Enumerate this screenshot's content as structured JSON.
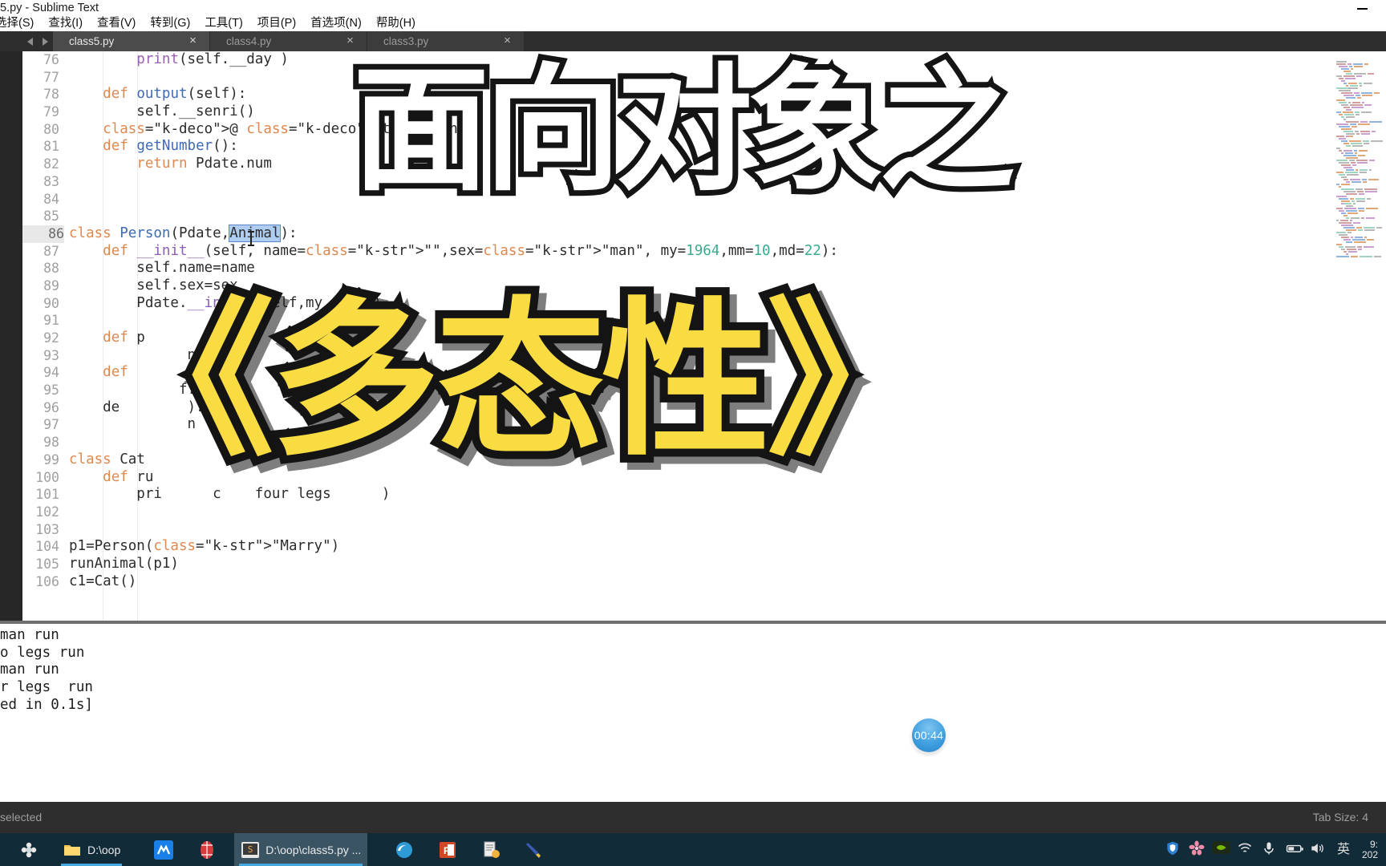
{
  "window": {
    "title": "5.py - Sublime Text",
    "minimize_label": "—"
  },
  "menubar": {
    "items": [
      {
        "label": "选择(S)",
        "name": "menu-select"
      },
      {
        "label": "查找(I)",
        "name": "menu-find"
      },
      {
        "label": "查看(V)",
        "name": "menu-view"
      },
      {
        "label": "转到(G)",
        "name": "menu-goto"
      },
      {
        "label": "工具(T)",
        "name": "menu-tools"
      },
      {
        "label": "项目(P)",
        "name": "menu-project"
      },
      {
        "label": "首选项(N)",
        "name": "menu-preferences"
      },
      {
        "label": "帮助(H)",
        "name": "menu-help"
      }
    ]
  },
  "tabs": {
    "nav_prev": "◀",
    "nav_next": "▶",
    "close_glyph": "×",
    "items": [
      {
        "label": "class5.py",
        "active": true
      },
      {
        "label": "class4.py",
        "active": false
      },
      {
        "label": "class3.py",
        "active": false
      }
    ]
  },
  "editor": {
    "first_line": 76,
    "cursor_line": 86,
    "selection_text": "Animal",
    "lines": [
      {
        "n": 76,
        "text": "        print(self.__day )"
      },
      {
        "n": 77,
        "text": ""
      },
      {
        "n": 78,
        "text": "    def output(self):"
      },
      {
        "n": 79,
        "text": "        self.__senri()"
      },
      {
        "n": 80,
        "text": "    @ staticmethod"
      },
      {
        "n": 81,
        "text": "    def getNumber():"
      },
      {
        "n": 82,
        "text": "        return Pdate.num"
      },
      {
        "n": 83,
        "text": ""
      },
      {
        "n": 84,
        "text": ""
      },
      {
        "n": 85,
        "text": ""
      },
      {
        "n": 86,
        "text": "class Person(Pdate,Animal):"
      },
      {
        "n": 87,
        "text": "    def __init__(self, name=\"\",sex=\"man\", my=1964,mm=10,md=22):"
      },
      {
        "n": 88,
        "text": "        self.name=name"
      },
      {
        "n": 89,
        "text": "        self.sex=sex"
      },
      {
        "n": 90,
        "text": "        Pdate.__init__(self,my,mm,md)"
      },
      {
        "n": 91,
        "text": ""
      },
      {
        "n": 92,
        "text": "    def p        lf):"
      },
      {
        "n": 93,
        "text": "              name"
      },
      {
        "n": 94,
        "text": "    def        elf)"
      },
      {
        "n": 95,
        "text": "             f.sex)"
      },
      {
        "n": 96,
        "text": "    de        ):"
      },
      {
        "n": 97,
        "text": "              n ·"
      },
      {
        "n": 98,
        "text": ""
      },
      {
        "n": 99,
        "text": "class Cat"
      },
      {
        "n": 100,
        "text": "    def ru"
      },
      {
        "n": 101,
        "text": "        pri      c    four legs      )"
      },
      {
        "n": 102,
        "text": ""
      },
      {
        "n": 103,
        "text": ""
      },
      {
        "n": 104,
        "text": "p1=Person(\"Marry\")"
      },
      {
        "n": 105,
        "text": "runAnimal(p1)"
      },
      {
        "n": 106,
        "text": "c1=Cat()"
      }
    ]
  },
  "console": {
    "lines": [
      "man run",
      "o legs run",
      "man run",
      "r legs  run",
      "ed in 0.1s]"
    ]
  },
  "statusbar": {
    "left": "selected",
    "right": "Tab Size: 4"
  },
  "timer": {
    "value": "00:44"
  },
  "overlay": {
    "top_text": "面向对象之",
    "main_text": "《多态性》",
    "main_color": "#F9DC42",
    "outline_color": "#141414"
  },
  "taskbar": {
    "items": [
      {
        "label": "",
        "icon": "flower-star-icon",
        "active": false,
        "running": false
      },
      {
        "label": "D:\\oop",
        "icon": "folder-icon",
        "active": false,
        "running": true
      },
      {
        "label": "",
        "icon": "blue-m-icon",
        "active": false,
        "running": false
      },
      {
        "label": "",
        "icon": "red-badge-icon",
        "active": false,
        "running": false
      },
      {
        "label": "D:\\oop\\class5.py ...",
        "icon": "sublime-text-icon",
        "active": true,
        "running": true
      },
      {
        "label": "",
        "icon": "edge-browser-icon",
        "active": false,
        "running": false
      },
      {
        "label": "",
        "icon": "powerpoint-icon",
        "active": false,
        "running": false
      },
      {
        "label": "",
        "icon": "scanner-document-icon",
        "active": false,
        "running": false
      },
      {
        "label": "",
        "icon": "pen-icon",
        "active": false,
        "running": false
      }
    ],
    "tray": [
      {
        "icon": "shield-icon"
      },
      {
        "icon": "flower-icon"
      },
      {
        "icon": "nvidia-icon"
      },
      {
        "icon": "wifi-icon"
      },
      {
        "icon": "microphone-icon"
      },
      {
        "icon": "battery-icon"
      },
      {
        "icon": "volume-icon"
      },
      {
        "icon": "ime-english-icon",
        "label": "英"
      }
    ],
    "clock_time": "9:",
    "clock_date": "202"
  }
}
